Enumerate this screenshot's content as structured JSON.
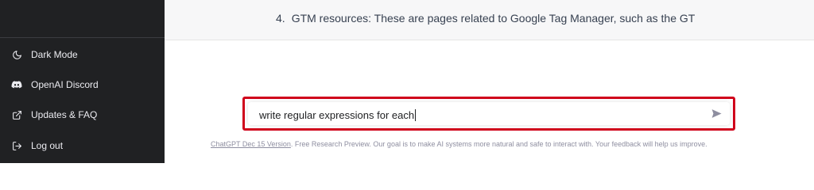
{
  "sidebar": {
    "items": [
      {
        "label": "Dark Mode",
        "icon": "moon-icon"
      },
      {
        "label": "OpenAI Discord",
        "icon": "discord-icon"
      },
      {
        "label": "Updates & FAQ",
        "icon": "external-link-icon"
      },
      {
        "label": "Log out",
        "icon": "logout-icon"
      }
    ]
  },
  "response": {
    "item_number": "4.",
    "item_text": "GTM resources: These are pages related to Google Tag Manager, such as the GT"
  },
  "prompt": {
    "value": "write regular expressions for each",
    "highlight_color": "#d0021b"
  },
  "footer": {
    "version_link": "ChatGPT Dec 15 Version",
    "note": ". Free Research Preview. Our goal is to make AI systems more natural and safe to interact with. Your feedback will help us improve."
  },
  "colors": {
    "sidebar_bg": "#202123",
    "response_bg": "#f7f7f8"
  }
}
